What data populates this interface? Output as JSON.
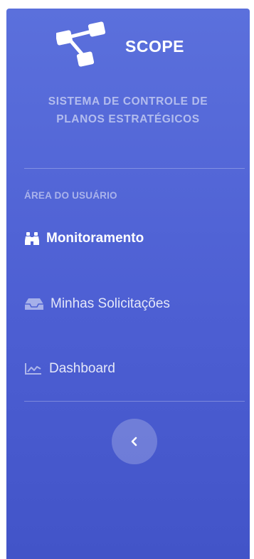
{
  "brand": {
    "name": "SCOPE",
    "subtitle_line1": "SISTEMA DE CONTROLE DE",
    "subtitle_line2": "PLANOS ESTRATÉGICOS",
    "logo_icon": "sitemap-icon"
  },
  "section": {
    "heading": "ÁREA DO USUÁRIO"
  },
  "nav": {
    "items": [
      {
        "label": "Monitoramento",
        "icon": "binoculars-icon",
        "active": true
      },
      {
        "label": "Minhas Solicitações",
        "icon": "inbox-icon",
        "active": false
      },
      {
        "label": "Dashboard",
        "icon": "area-chart-icon",
        "active": false
      }
    ]
  },
  "sidebar_toggle": {
    "icon": "chevron-left-icon"
  },
  "colors": {
    "sidebar_top": "#5b70dc",
    "sidebar_bottom": "#4254c8",
    "text": "#ffffff"
  }
}
